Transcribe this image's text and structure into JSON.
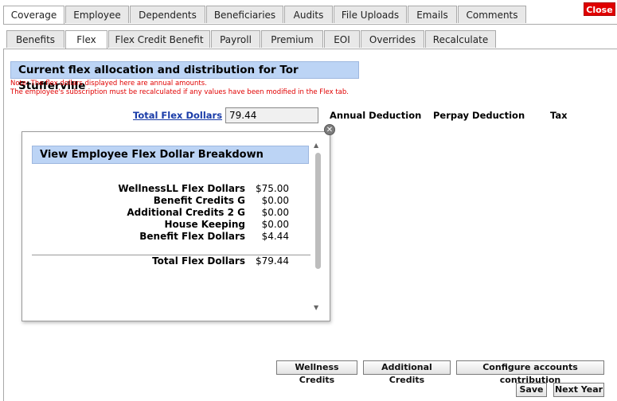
{
  "top_tabs": [
    "Coverage",
    "Employee",
    "Dependents",
    "Beneficiaries",
    "Audits",
    "File Uploads",
    "Emails",
    "Comments"
  ],
  "close_label": "Close",
  "sub_tabs": [
    "Benefits",
    "Flex",
    "Flex Credit Benefit",
    "Payroll",
    "Premium",
    "EOI",
    "Overrides",
    "Recalculate"
  ],
  "page_title": "Current flex allocation and distribution for Tor Stufferville",
  "notes": [
    "Note: The flex dollars displayed here are annual amounts.",
    "The employee's subscription must be recalculated if any values have been modified in the Flex tab."
  ],
  "total_flex_label": "Total Flex Dollars",
  "total_flex_value": "79.44",
  "columns": [
    "Annual Deduction",
    "Perpay Deduction",
    "Tax"
  ],
  "popup": {
    "title": "View Employee Flex Dollar Breakdown",
    "rows": [
      {
        "label": "WellnessLL Flex Dollars",
        "amount": "$75.00"
      },
      {
        "label": "Benefit Credits G",
        "amount": "$0.00"
      },
      {
        "label": "Additional Credits 2 G",
        "amount": "$0.00"
      },
      {
        "label": "House Keeping",
        "amount": "$0.00"
      },
      {
        "label": "Benefit Flex Dollars",
        "amount": "$4.44"
      }
    ],
    "total": {
      "label": "Total Flex Dollars",
      "amount": "$79.44"
    }
  },
  "buttons": {
    "wellness": "Wellness Credits",
    "additional": "Additional Credits",
    "configure": "Configure accounts contribution",
    "save": "Save",
    "next_year": "Next Year"
  }
}
